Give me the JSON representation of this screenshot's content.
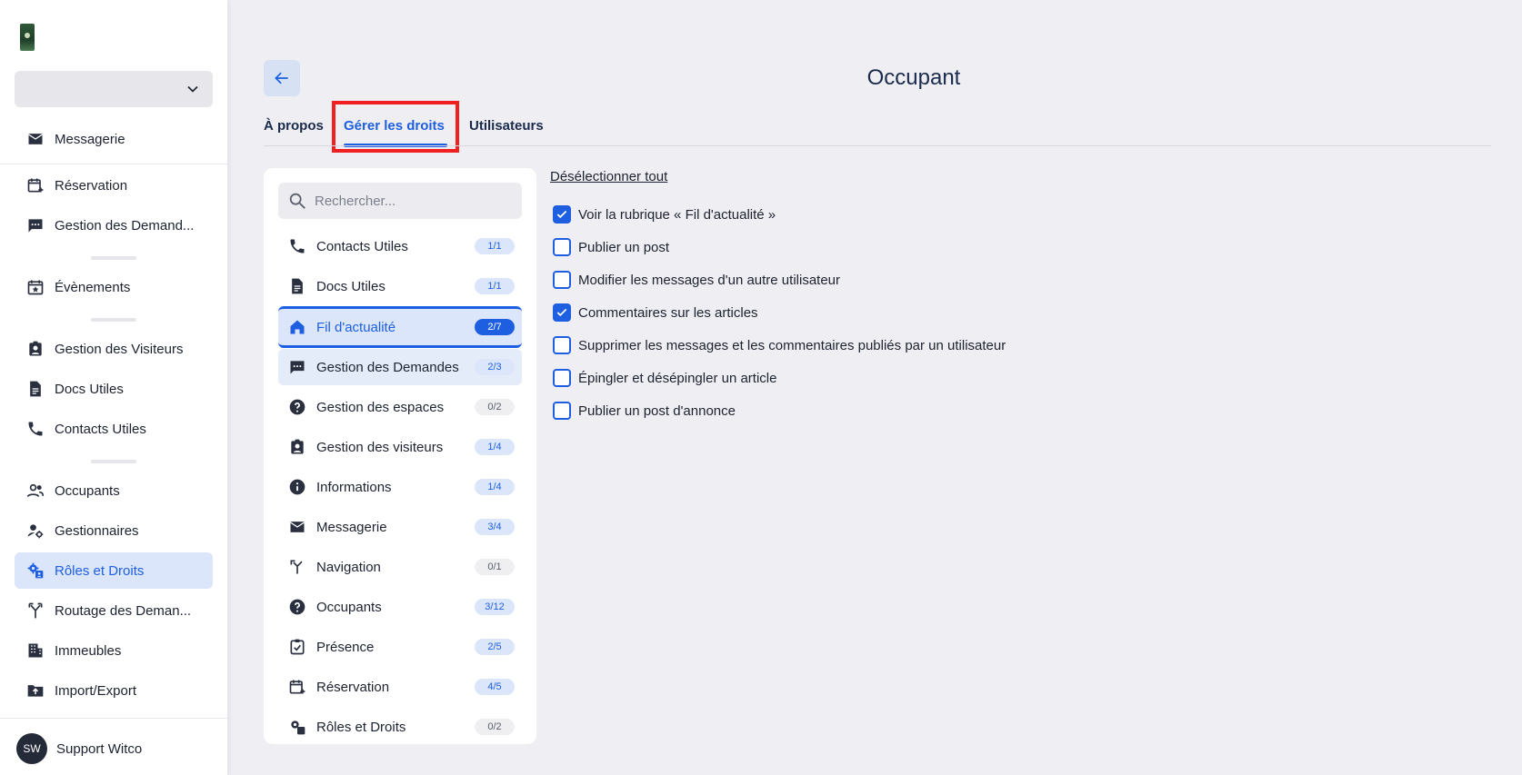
{
  "sidebar": {
    "items": [
      {
        "label": "Messagerie",
        "icon": "mail-icon"
      },
      {
        "label": "Réservation",
        "icon": "calendar-add-icon"
      },
      {
        "label": "Gestion des Demand...",
        "icon": "chat-icon"
      },
      {
        "label": "Évènements",
        "icon": "calendar-star-icon"
      },
      {
        "label": "Gestion des Visiteurs",
        "icon": "visitor-badge-icon"
      },
      {
        "label": "Docs Utiles",
        "icon": "document-icon"
      },
      {
        "label": "Contacts Utiles",
        "icon": "phone-icon"
      },
      {
        "label": "Occupants",
        "icon": "users-icon"
      },
      {
        "label": "Gestionnaires",
        "icon": "user-gear-icon"
      },
      {
        "label": "Rôles et Droits",
        "icon": "roles-gear-icon"
      },
      {
        "label": "Routage des Deman...",
        "icon": "routing-icon"
      },
      {
        "label": "Immeubles",
        "icon": "building-icon"
      },
      {
        "label": "Import/Export",
        "icon": "folder-upload-icon"
      }
    ],
    "user": {
      "initials": "SW",
      "name": "Support Witco"
    }
  },
  "header": {
    "title": "Occupant",
    "tabs": [
      {
        "label": "À propos"
      },
      {
        "label": "Gérer les droits"
      },
      {
        "label": "Utilisateurs"
      }
    ]
  },
  "modules": {
    "search_placeholder": "Rechercher...",
    "items": [
      {
        "label": "Contacts Utiles",
        "badge": "1/1",
        "icon": "phone-icon"
      },
      {
        "label": "Docs Utiles",
        "badge": "1/1",
        "icon": "document-icon"
      },
      {
        "label": "Fil d'actualité",
        "badge": "2/7",
        "icon": "home-icon"
      },
      {
        "label": "Gestion des Demandes",
        "badge": "2/3",
        "icon": "chat-icon"
      },
      {
        "label": "Gestion des espaces",
        "badge": "0/2",
        "icon": "help-icon"
      },
      {
        "label": "Gestion des visiteurs",
        "badge": "1/4",
        "icon": "visitor-badge-icon"
      },
      {
        "label": "Informations",
        "badge": "1/4",
        "icon": "info-icon"
      },
      {
        "label": "Messagerie",
        "badge": "3/4",
        "icon": "mail-icon"
      },
      {
        "label": "Navigation",
        "badge": "0/1",
        "icon": "navigation-icon"
      },
      {
        "label": "Occupants",
        "badge": "3/12",
        "icon": "help-icon"
      },
      {
        "label": "Présence",
        "badge": "2/5",
        "icon": "clipboard-check-icon"
      },
      {
        "label": "Réservation",
        "badge": "4/5",
        "icon": "calendar-add-icon"
      },
      {
        "label": "Rôles et Droits",
        "badge": "0/2",
        "icon": "roles-gear-icon"
      }
    ]
  },
  "permissions": {
    "deselect_all": "Désélectionner tout",
    "items": [
      {
        "label": "Voir la rubrique « Fil d'actualité »",
        "checked": true
      },
      {
        "label": "Publier un post",
        "checked": false
      },
      {
        "label": "Modifier les messages d'un autre utilisateur",
        "checked": false
      },
      {
        "label": "Commentaires sur les articles",
        "checked": true
      },
      {
        "label": "Supprimer les messages et les commentaires publiés par un utilisateur",
        "checked": false
      },
      {
        "label": "Épingler et désépingler un article",
        "checked": false
      },
      {
        "label": "Publier un post d'annonce",
        "checked": false
      }
    ]
  },
  "colors": {
    "accent": "#1d5fe0",
    "highlight": "#f02020",
    "text": "#1c2230"
  }
}
